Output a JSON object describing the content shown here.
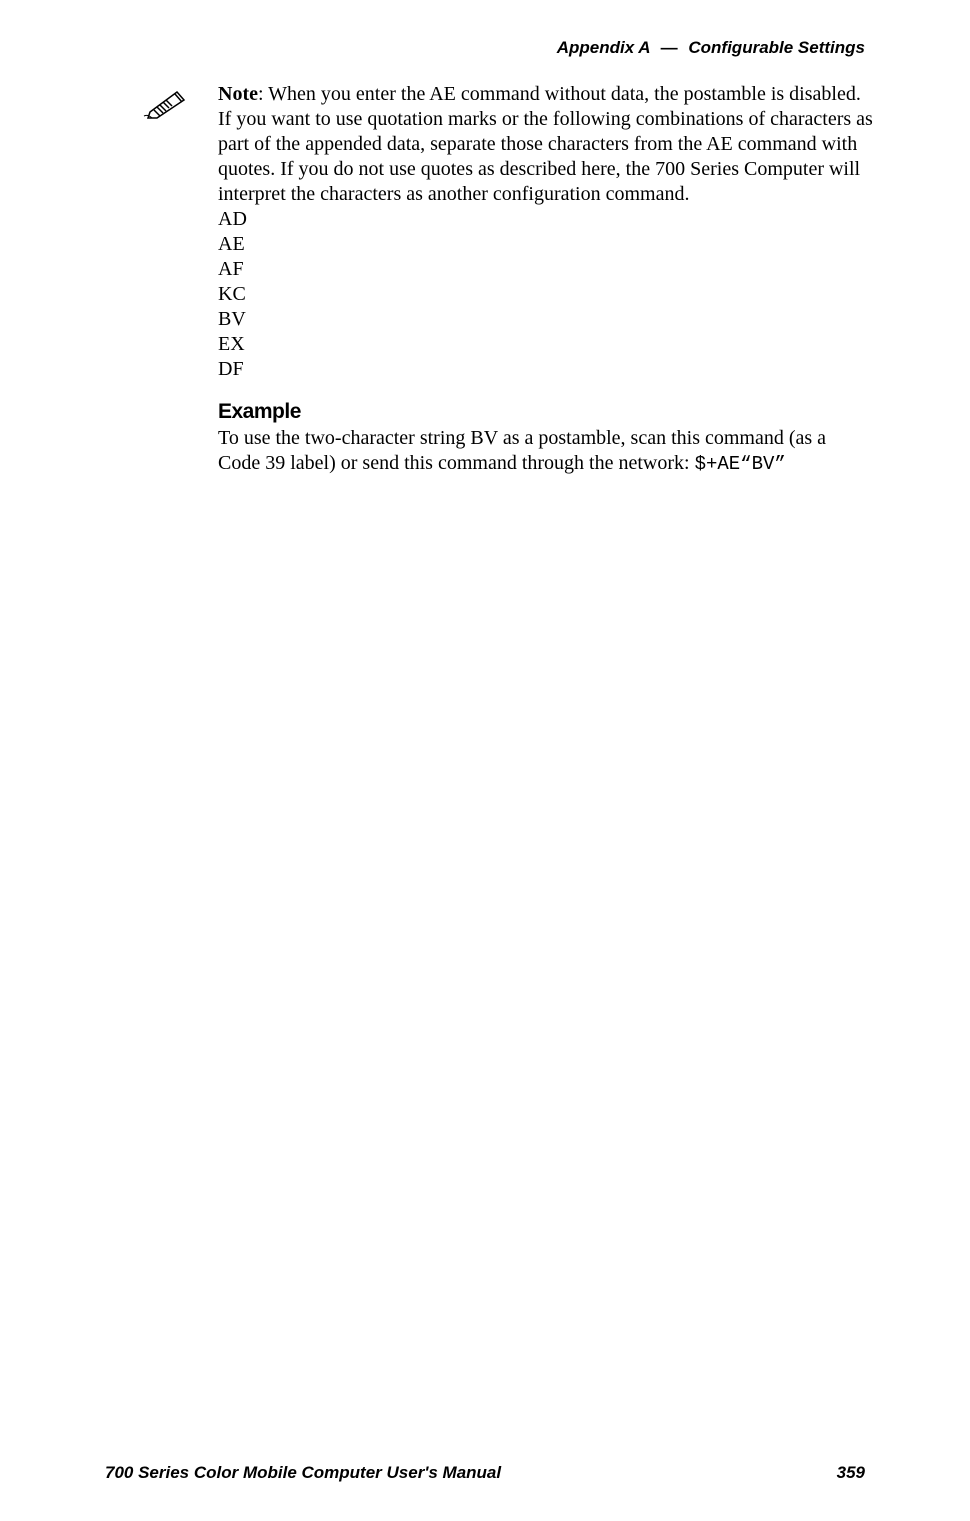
{
  "header": {
    "appendix": "Appendix A",
    "dash": "—",
    "section": "Configurable Settings"
  },
  "note": {
    "label": "Note",
    "text": ": When you enter the AE command without data, the postamble is disabled. If you want to use quotation marks or the following combinations of characters as part of the appended data, separate those characters from the AE command with quotes. If you do not use quotes as described here, the 700 Series Computer will interpret the characters as another configuration command.",
    "codes": [
      "AD",
      "AE",
      "AF",
      "KC",
      "BV",
      "EX",
      "DF"
    ]
  },
  "example": {
    "heading": "Example",
    "text_before": "To use the two-character string BV as a postamble, scan this command (as a Code 39 label) or send this command through the network: ",
    "command": "$+AE“BV”"
  },
  "footer": {
    "manual": "700 Series Color Mobile Computer User's Manual",
    "page": "359"
  }
}
